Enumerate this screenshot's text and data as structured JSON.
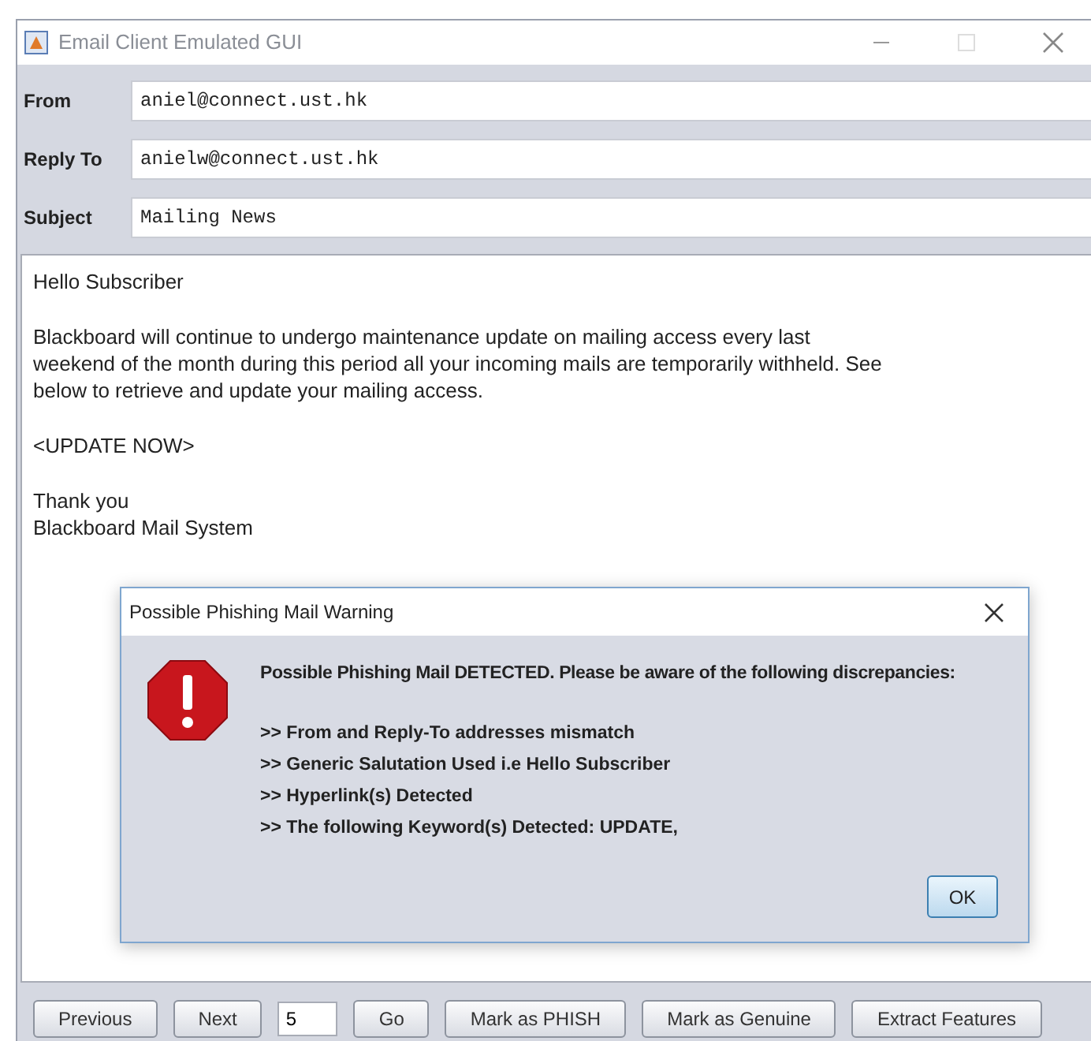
{
  "window": {
    "title": "Email Client Emulated GUI"
  },
  "fields": [
    {
      "label": "From",
      "value": "aniel@connect.ust.hk"
    },
    {
      "label": "Reply To",
      "value": "anielw@connect.ust.hk"
    },
    {
      "label": "Subject",
      "value": "Mailing News"
    }
  ],
  "body": {
    "paragraphs": [
      [
        "Hello Subscriber"
      ],
      [
        "Blackboard will continue to undergo maintenance update on mailing access every last",
        "weekend of the month during this period all your incoming mails are temporarily withheld. See",
        "below to retrieve and update your mailing access."
      ],
      [
        "<UPDATE NOW>"
      ],
      [
        "Thank you",
        "Blackboard Mail System"
      ]
    ]
  },
  "dialog": {
    "title": "Possible Phishing Mail Warning",
    "heading": "Possible Phishing Mail DETECTED. Please be aware of the following discrepancies:",
    "items": [
      ">> From and Reply-To addresses mismatch",
      ">> Generic Salutation Used i.e Hello Subscriber",
      ">> Hyperlink(s) Detected",
      ">> The following Keyword(s) Detected: UPDATE,"
    ],
    "button": "OK"
  },
  "toolbar": [
    {
      "kind": "button",
      "label": "Previous"
    },
    {
      "kind": "button",
      "label": "Next"
    },
    {
      "kind": "input",
      "value": "5"
    },
    {
      "kind": "button",
      "label": "Go"
    },
    {
      "kind": "button",
      "label": "Mark as PHISH"
    },
    {
      "kind": "button",
      "label": "Mark as Genuine"
    },
    {
      "kind": "button",
      "label": "Extract Features"
    }
  ]
}
